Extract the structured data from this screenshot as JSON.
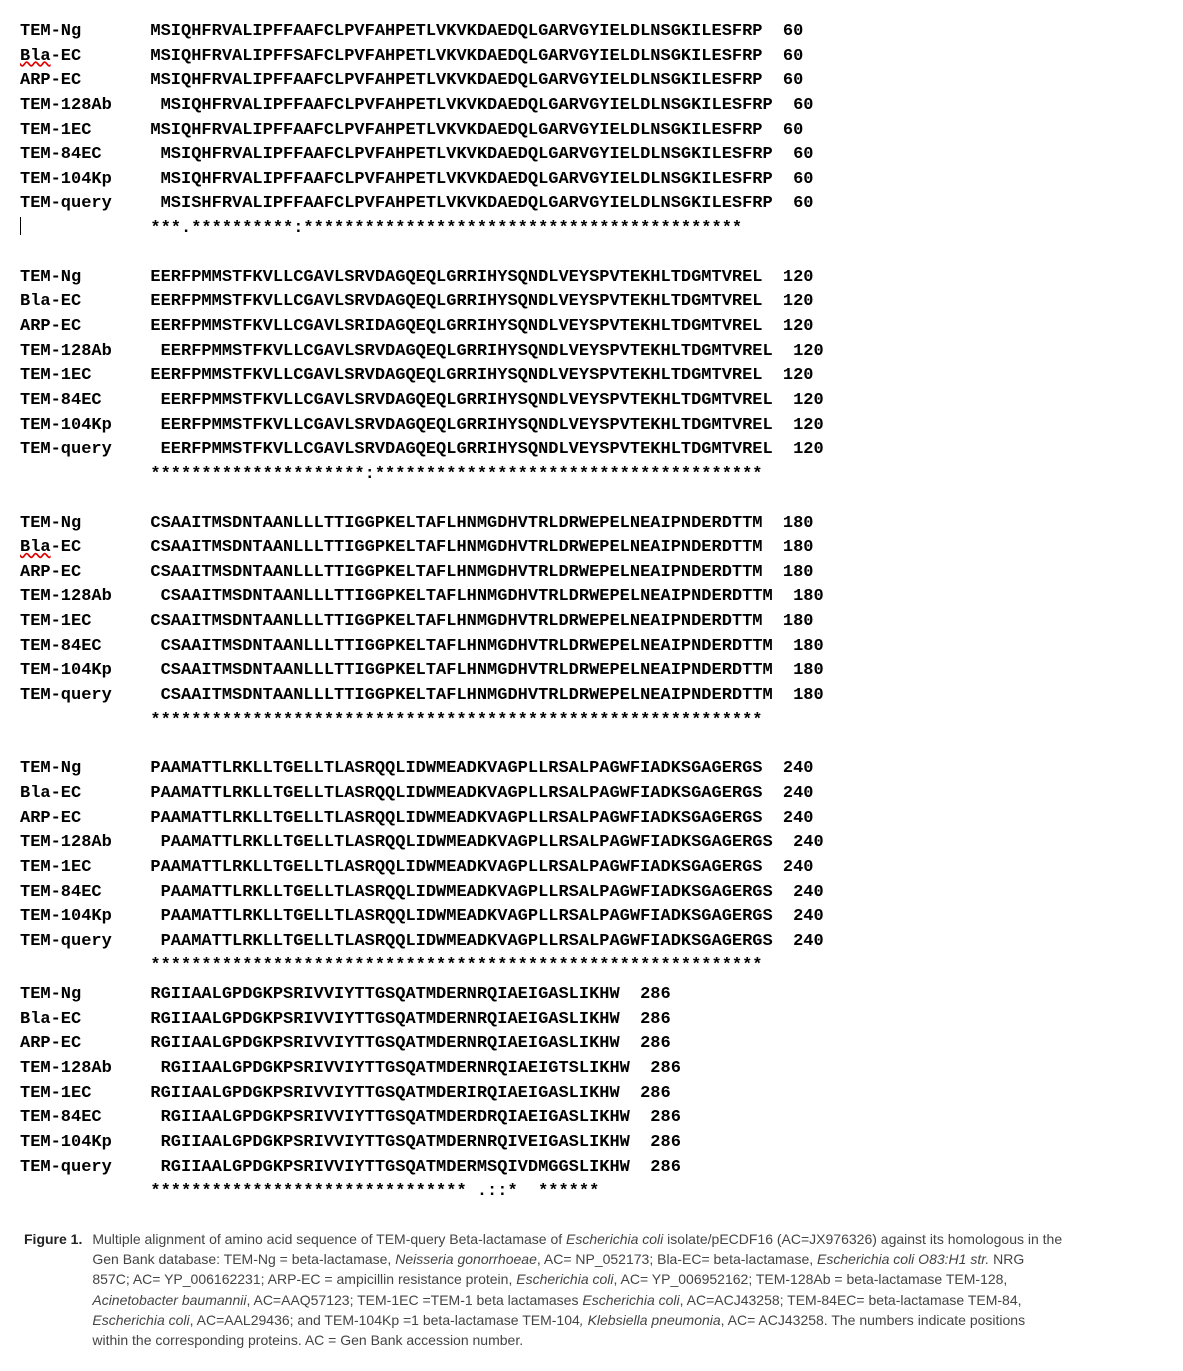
{
  "blocks": [
    {
      "rows": [
        {
          "label": "TEM-Ng",
          "indent": "  ",
          "seq": "MSIQHFRVALIPFFAAFCLPVFAHPETLVKVKDAEDQLGARVGYIELDLNSGKILESFRP",
          "end": "60"
        },
        {
          "label": "Bla-EC",
          "labelMarkup": "underline-bla",
          "indent": "  ",
          "seq": "MSIQHFRVALIPFFSAFCLPVFAHPETLVKVKDAEDQLGARVGYIELDLNSGKILESFRP",
          "end": "60"
        },
        {
          "label": "ARP-EC",
          "indent": "  ",
          "seq": "MSIQHFRVALIPFFAAFCLPVFAHPETLVKVKDAEDQLGARVGYIELDLNSGKILESFRP",
          "end": "60"
        },
        {
          "label": "TEM-128Ab",
          "indent": "   ",
          "seq": "MSIQHFRVALIPFFAAFCLPVFAHPETLVKVKDAEDQLGARVGYIELDLNSGKILESFRP",
          "end": "60"
        },
        {
          "label": "TEM-1EC",
          "indent": "  ",
          "seq": "MSIQHFRVALIPFFAAFCLPVFAHPETLVKVKDAEDQLGARVGYIELDLNSGKILESFRP",
          "end": "60"
        },
        {
          "label": "TEM-84EC",
          "indent": "   ",
          "seq": "MSIQHFRVALIPFFAAFCLPVFAHPETLVKVKDAEDQLGARVGYIELDLNSGKILESFRP",
          "end": "60"
        },
        {
          "label": "TEM-104Kp",
          "indent": "   ",
          "seq": "MSIQHFRVALIPFFAAFCLPVFAHPETLVKVKDAEDQLGARVGYIELDLNSGKILESFRP",
          "end": "60"
        },
        {
          "label": "TEM-query",
          "indent": "   ",
          "seq": "MSISHFRVALIPFFAAFCLPVFAHPETLVKVKDAEDQLGARVGYIELDLNSGKILESFRP",
          "end": "60"
        }
      ],
      "conservation": "  ***.**********:*******************************************",
      "showCursor": true
    },
    {
      "rows": [
        {
          "label": "TEM-Ng",
          "indent": "  ",
          "seq": "EERFPMMSTFKVLLCGAVLSRVDAGQEQLGRRIHYSQNDLVEYSPVTEKHLTDGMTVREL",
          "end": "120"
        },
        {
          "label": "Bla-EC",
          "indent": "  ",
          "seq": "EERFPMMSTFKVLLCGAVLSRVDAGQEQLGRRIHYSQNDLVEYSPVTEKHLTDGMTVREL",
          "end": "120"
        },
        {
          "label": "ARP-EC",
          "indent": "  ",
          "seq": "EERFPMMSTFKVLLCGAVLSRIDAGQEQLGRRIHYSQNDLVEYSPVTEKHLTDGMTVREL",
          "end": "120"
        },
        {
          "label": "TEM-128Ab",
          "indent": "   ",
          "seq": "EERFPMMSTFKVLLCGAVLSRVDAGQEQLGRRIHYSQNDLVEYSPVTEKHLTDGMTVREL",
          "end": "120"
        },
        {
          "label": "TEM-1EC",
          "indent": "  ",
          "seq": "EERFPMMSTFKVLLCGAVLSRVDAGQEQLGRRIHYSQNDLVEYSPVTEKHLTDGMTVREL",
          "end": "120"
        },
        {
          "label": "TEM-84EC",
          "indent": "   ",
          "seq": "EERFPMMSTFKVLLCGAVLSRVDAGQEQLGRRIHYSQNDLVEYSPVTEKHLTDGMTVREL",
          "end": "120"
        },
        {
          "label": "TEM-104Kp",
          "indent": "   ",
          "seq": "EERFPMMSTFKVLLCGAVLSRVDAGQEQLGRRIHYSQNDLVEYSPVTEKHLTDGMTVREL",
          "end": "120"
        },
        {
          "label": "TEM-query",
          "indent": "   ",
          "seq": "EERFPMMSTFKVLLCGAVLSRVDAGQEQLGRRIHYSQNDLVEYSPVTEKHLTDGMTVREL",
          "end": "120"
        }
      ],
      "conservation": "  *********************:**************************************"
    },
    {
      "rows": [
        {
          "label": "TEM-Ng",
          "indent": "  ",
          "seq": "CSAAITMSDNTAANLLLTTIGGPKELTAFLHNMGDHVTRLDRWEPELNEAIPNDERDTTM",
          "end": "180"
        },
        {
          "label": "Bla-EC",
          "labelMarkup": "underline-bla",
          "indent": "  ",
          "seq": "CSAAITMSDNTAANLLLTTIGGPKELTAFLHNMGDHVTRLDRWEPELNEAIPNDERDTTM",
          "end": "180"
        },
        {
          "label": "ARP-EC",
          "indent": "  ",
          "seq": "CSAAITMSDNTAANLLLTTIGGPKELTAFLHNMGDHVTRLDRWEPELNEAIPNDERDTTM",
          "end": "180"
        },
        {
          "label": "TEM-128Ab",
          "indent": "   ",
          "seq": "CSAAITMSDNTAANLLLTTIGGPKELTAFLHNMGDHVTRLDRWEPELNEAIPNDERDTTM",
          "end": "180"
        },
        {
          "label": "TEM-1EC",
          "indent": "  ",
          "seq": "CSAAITMSDNTAANLLLTTIGGPKELTAFLHNMGDHVTRLDRWEPELNEAIPNDERDTTM",
          "end": "180"
        },
        {
          "label": "TEM-84EC",
          "indent": "   ",
          "seq": "CSAAITMSDNTAANLLLTTIGGPKELTAFLHNMGDHVTRLDRWEPELNEAIPNDERDTTM",
          "end": "180"
        },
        {
          "label": "TEM-104Kp",
          "indent": "   ",
          "seq": "CSAAITMSDNTAANLLLTTIGGPKELTAFLHNMGDHVTRLDRWEPELNEAIPNDERDTTM",
          "end": "180"
        },
        {
          "label": "TEM-query",
          "indent": "   ",
          "seq": "CSAAITMSDNTAANLLLTTIGGPKELTAFLHNMGDHVTRLDRWEPELNEAIPNDERDTTM",
          "end": "180"
        }
      ],
      "conservation": "  ************************************************************"
    },
    {
      "tight": true,
      "rows": [
        {
          "label": "TEM-Ng",
          "indent": "  ",
          "seq": "PAAMATTLRKLLTGELLTLASRQQLIDWMEADKVAGPLLRSALPAGWFIADKSGAGERGS",
          "end": "240"
        },
        {
          "label": "Bla-EC",
          "indent": "  ",
          "seq": "PAAMATTLRKLLTGELLTLASRQQLIDWMEADKVAGPLLRSALPAGWFIADKSGAGERGS",
          "end": "240"
        },
        {
          "label": "ARP-EC",
          "indent": "  ",
          "seq": "PAAMATTLRKLLTGELLTLASRQQLIDWMEADKVAGPLLRSALPAGWFIADKSGAGERGS",
          "end": "240"
        },
        {
          "label": "TEM-128Ab",
          "indent": "   ",
          "seq": "PAAMATTLRKLLTGELLTLASRQQLIDWMEADKVAGPLLRSALPAGWFIADKSGAGERGS",
          "end": "240"
        },
        {
          "label": "TEM-1EC",
          "indent": "  ",
          "seq": "PAAMATTLRKLLTGELLTLASRQQLIDWMEADKVAGPLLRSALPAGWFIADKSGAGERGS",
          "end": "240"
        },
        {
          "label": "TEM-84EC",
          "indent": "   ",
          "seq": "PAAMATTLRKLLTGELLTLASRQQLIDWMEADKVAGPLLRSALPAGWFIADKSGAGERGS",
          "end": "240"
        },
        {
          "label": "TEM-104Kp",
          "indent": "   ",
          "seq": "PAAMATTLRKLLTGELLTLASRQQLIDWMEADKVAGPLLRSALPAGWFIADKSGAGERGS",
          "end": "240"
        },
        {
          "label": "TEM-query",
          "indent": "   ",
          "seq": "PAAMATTLRKLLTGELLTLASRQQLIDWMEADKVAGPLLRSALPAGWFIADKSGAGERGS",
          "end": "240"
        }
      ],
      "conservation": "  ************************************************************"
    },
    {
      "rows": [
        {
          "label": "TEM-Ng",
          "indent": "  ",
          "seq": "RGIIAALGPDGKPSRIVVIYTTGSQATMDERNRQIAEIGASLIKHW",
          "end": "286"
        },
        {
          "label": "Bla-EC",
          "indent": "  ",
          "seq": "RGIIAALGPDGKPSRIVVIYTTGSQATMDERNRQIAEIGASLIKHW",
          "end": "286"
        },
        {
          "label": "ARP-EC",
          "indent": "  ",
          "seq": "RGIIAALGPDGKPSRIVVIYTTGSQATMDERNRQIAEIGASLIKHW",
          "end": "286"
        },
        {
          "label": "TEM-128Ab",
          "indent": "   ",
          "seq": "RGIIAALGPDGKPSRIVVIYTTGSQATMDERNRQIAEIGTSLIKHW",
          "end": "286"
        },
        {
          "label": "TEM-1EC",
          "indent": "  ",
          "seq": "RGIIAALGPDGKPSRIVVIYTTGSQATMDERIRQIAEIGASLIKHW",
          "end": "286"
        },
        {
          "label": "TEM-84EC",
          "indent": "   ",
          "seq": "RGIIAALGPDGKPSRIVVIYTTGSQATMDERDRQIAEIGASLIKHW",
          "end": "286"
        },
        {
          "label": "TEM-104Kp",
          "indent": "   ",
          "seq": "RGIIAALGPDGKPSRIVVIYTTGSQATMDERNRQIVEIGASLIKHW",
          "end": "286"
        },
        {
          "label": "TEM-query",
          "indent": "   ",
          "seq": "RGIIAALGPDGKPSRIVVIYTTGSQATMDERMSQIVDMGGSLIKHW",
          "end": "286"
        }
      ],
      "conservation": "  ******************************* .::*  ******"
    }
  ],
  "caption": {
    "label": "Figure 1.",
    "html": "Multiple alignment of amino acid sequence of TEM-query Beta-lactamase of <em>Escherichia coli</em> isolate/pECDF16 (AC=JX976326) against its homologous in the Gen Bank database: TEM-Ng = beta-lactamase, <em>Neisseria gonorrhoeae</em>, AC= NP_052173; Bla-EC= beta-lactamase, <em>Escherichia coli O83:H1 str.</em> NRG 857C; AC= YP_006162231; ARP-EC = ampicillin resistance protein, <em>Escherichia coli</em>, AC= YP_006952162; TEM-128Ab = beta-lactamase TEM-128, <em>Acinetobacter baumannii</em>, AC=AAQ57123; TEM-1EC =TEM-1 beta lactamases <em>Escherichia coli</em>, AC=ACJ43258; TEM-84EC= beta-lactamase TEM-84, <em>Escherichia coli</em>, AC=AAL29436; and TEM-104Kp =1 beta-lactamase TEM-104<em>, Klebsiella pneumonia</em>, AC= ACJ43258. The numbers indicate positions within the corresponding proteins. AC = Gen Bank accession number."
  }
}
